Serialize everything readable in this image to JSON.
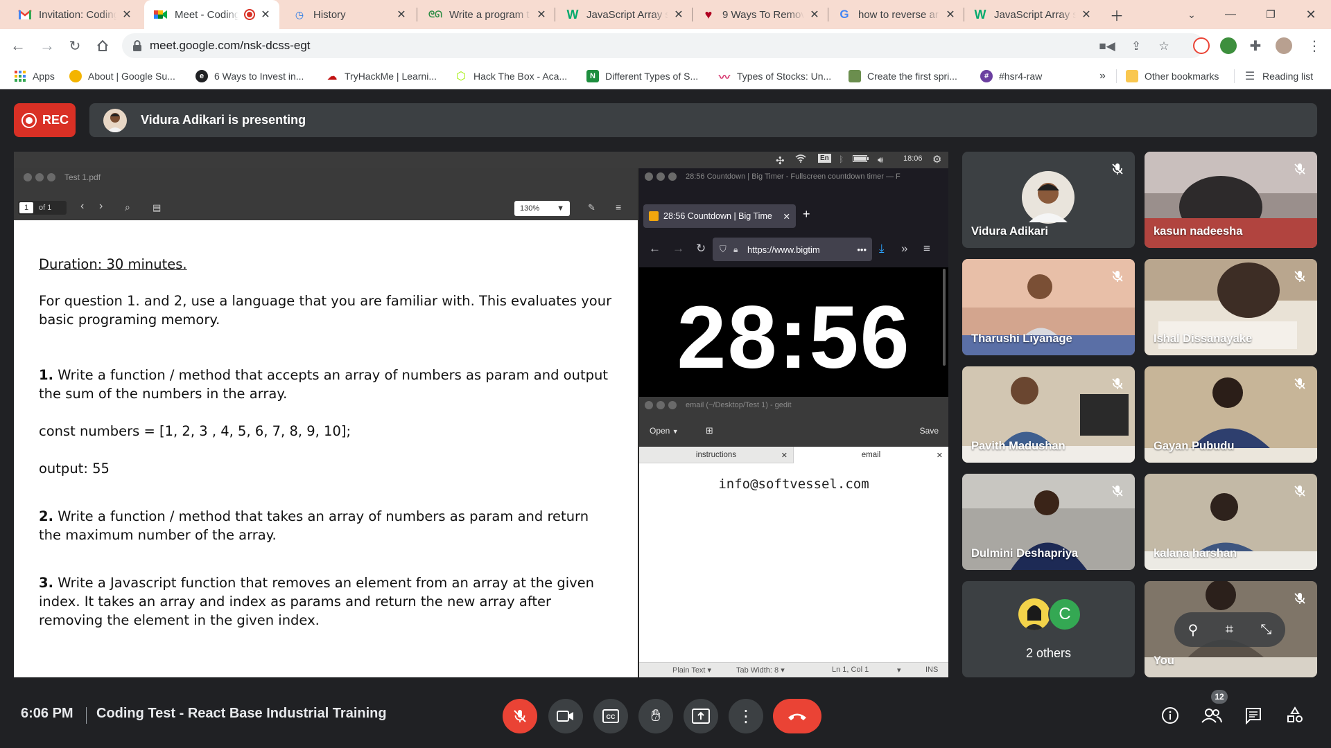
{
  "tabs": [
    {
      "title": "Invitation: Coding",
      "favicon": "gmail-icon"
    },
    {
      "title": "Meet - Coding",
      "favicon": "meet-icon",
      "active": true
    },
    {
      "title": "History",
      "favicon": "history-icon"
    },
    {
      "title": "Write a program t",
      "favicon": "gfg-icon"
    },
    {
      "title": "JavaScript Array s",
      "favicon": "w3schools-icon"
    },
    {
      "title": "9 Ways To Remov",
      "favicon": "heart-icon"
    },
    {
      "title": "how to reverse ar",
      "favicon": "google-icon"
    },
    {
      "title": "JavaScript Array s",
      "favicon": "w3schools-icon"
    }
  ],
  "address": {
    "url": "meet.google.com/nsk-dcss-egt"
  },
  "bookmarks": {
    "apps": "Apps",
    "items": [
      "About | Google Su...",
      "6 Ways to Invest in...",
      "TryHackMe | Learni...",
      "Hack The Box - Aca...",
      "Different Types of S...",
      "Types of Stocks: Un...",
      "Create the first spri...",
      "#hsr4-raw"
    ],
    "overflow": "»",
    "other": "Other bookmarks",
    "reading": "Reading list"
  },
  "meet": {
    "rec_label": "REC",
    "presenting_text": "Vidura Adikari is presenting",
    "clock": "6:06 PM",
    "meeting_title": "Coding Test - React Base Industrial Training",
    "people_count": "12"
  },
  "shared": {
    "topbar": {
      "lang": "En",
      "time": "18:06"
    },
    "pdf": {
      "title": "Test 1.pdf",
      "page_current": "1",
      "page_total": "of 1",
      "zoom": "130%",
      "duration": "Duration: 30 minutes.",
      "intro": "For question 1. and 2, use a language that you are familiar with. This evaluates your basic programing memory.",
      "q1_num": "1.",
      "q1_text": "Write a function / method that accepts an array of numbers as param and output the sum of the numbers in the array.",
      "q1_code": "const numbers = [1, 2, 3 , 4, 5, 6, 7, 8, 9, 10];",
      "q1_output": "output: 55",
      "q2_num": "2.",
      "q2_text": "Write a function / method that takes an array of numbers as param and return the maximum number of the array.",
      "q3_num": "3.",
      "q3_text": "Write a Javascript function that removes an element from an array at the given index. It takes an array and index as params and return the new array after removing the element in the given index."
    },
    "firefox": {
      "window_title": "28:56 Countdown | Big Timer - Fullscreen countdown timer — F",
      "tab_title": "28:56 Countdown | Big Time",
      "url": "https://www.bigtim",
      "timer": "28:56"
    },
    "gedit": {
      "window_title": "email (~/Desktop/Test 1) - gedit",
      "open_label": "Open",
      "save_label": "Save",
      "tab1": "instructions",
      "tab2": "email",
      "content": "info@softvessel.com",
      "status_plain": "Plain Text",
      "status_tab": "Tab Width: 8",
      "status_pos": "Ln 1, Col 1",
      "status_ins": "INS"
    }
  },
  "participants": [
    {
      "name": "Vidura Adikari"
    },
    {
      "name": "kasun nadeesha"
    },
    {
      "name": "Tharushi Liyanage"
    },
    {
      "name": "Ishal Dissanayake"
    },
    {
      "name": "Pavith Madushan"
    },
    {
      "name": "Gayan Pubudu"
    },
    {
      "name": "Dulmini Deshapriya"
    },
    {
      "name": "kalana harshan"
    },
    {
      "name": "2 others",
      "avatar_letter": "C"
    },
    {
      "name": "You"
    }
  ],
  "colors": {
    "tabstrip": "#f7dcd1",
    "meet_bg": "#202124",
    "rec": "#d93025",
    "leave": "#ea4335",
    "avatar_c": "#34a853"
  }
}
